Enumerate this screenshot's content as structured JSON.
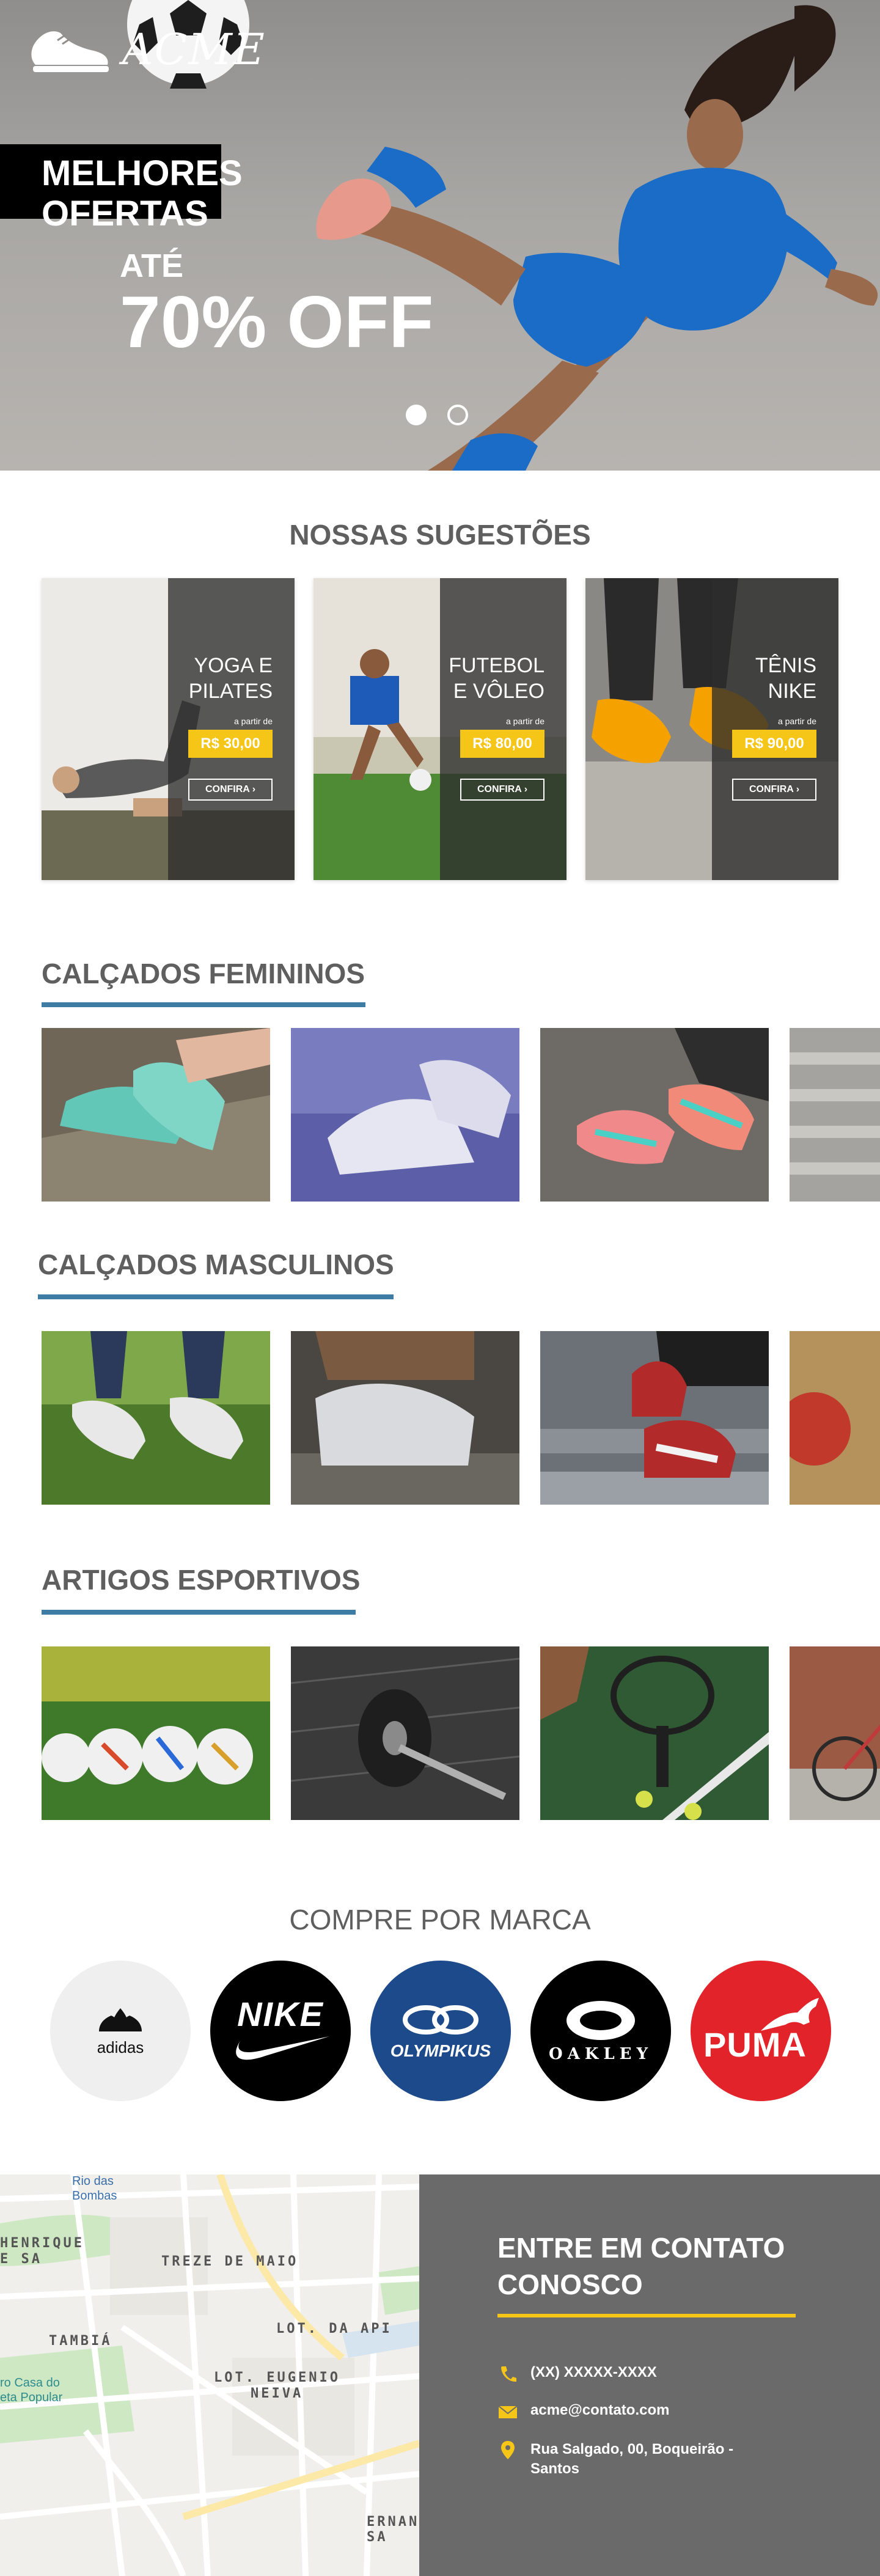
{
  "hero": {
    "logo_text": "ACME",
    "line1": "MELHORES",
    "line2": "OFERTAS",
    "until": "ATÉ",
    "discount": "70% OFF"
  },
  "suggestions": {
    "title": "NOSSAS SUGESTÕES",
    "cards": [
      {
        "name": "YOGA E\nPILATES",
        "from": "a partir de",
        "price": "R$ 30,00",
        "cta": "CONFIRA"
      },
      {
        "name": "FUTEBOL\nE VÔLEO",
        "from": "a partir de",
        "price": "R$ 80,00",
        "cta": "CONFIRA"
      },
      {
        "name": "TÊNIS\nNIKE",
        "from": "a partir de",
        "price": "R$ 90,00",
        "cta": "CONFIRA"
      }
    ]
  },
  "sections": {
    "female": "CALÇADOS FEMININOS",
    "male": "CALÇADOS MASCULINOS",
    "sports": "ARTIGOS ESPORTIVOS"
  },
  "brands": {
    "title": "COMPRE POR MARCA",
    "items": [
      "adidas",
      "NIKE",
      "OLYMPIKUS",
      "OAKLEY",
      "PUMA"
    ]
  },
  "map": {
    "labels": [
      "Rio das",
      "Bombas",
      "HENRIQUE",
      "E SA",
      "TREZE DE MAIO",
      "TAMBIÁ",
      "LOT. DA API",
      "LOT. EUGENIO",
      "NEIVA",
      "ERNANI SA",
      "ro Casa do",
      "eta Popular"
    ]
  },
  "contact": {
    "title": "ENTRE EM CONTATO CONOSCO",
    "phone": "(XX) XXXXX-XXXX",
    "email": "acme@contato.com",
    "address": "Rua Salgado, 00, Boqueirão - Santos"
  },
  "colors": {
    "accent_blue": "#3f7ca3",
    "accent_yellow": "#f5c518",
    "footer_gray": "#6a6a6a",
    "puma_red": "#e2232a",
    "olympikus_blue": "#1d4a8a"
  }
}
